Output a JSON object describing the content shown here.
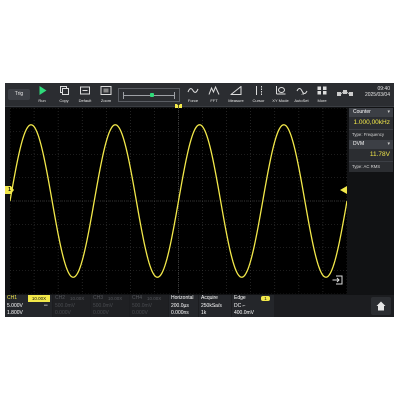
{
  "toolbar": {
    "trig": "Trig",
    "buttons": [
      "Run",
      "Copy",
      "Default",
      "Zoom",
      "Force",
      "FFT",
      "Measure",
      "Cursor",
      "XY Mode",
      "AutoSet",
      "More"
    ]
  },
  "status": {
    "time": "09:40",
    "date": "2025/03/04"
  },
  "markers": {
    "trigger_level": "T",
    "ch1": "1"
  },
  "counter": {
    "title": "Counter",
    "value": "1.000,00kHz",
    "type": "Type: Frequency"
  },
  "dvm": {
    "title": "DVM",
    "value": "11.78V",
    "type": "Type: AC RMS"
  },
  "channels": [
    {
      "name": "CH1",
      "probe": "10.00X",
      "scale": "5.000V",
      "offset": "1.800V",
      "active": true
    },
    {
      "name": "CH2",
      "probe": "10.00X",
      "scale": "500.0mV",
      "offset": "0.000V",
      "active": false
    },
    {
      "name": "CH3",
      "probe": "10.00X",
      "scale": "500.0mV",
      "offset": "0.000V",
      "active": false
    },
    {
      "name": "CH4",
      "probe": "10.00X",
      "scale": "500.0mV",
      "offset": "0.000V",
      "active": false
    }
  ],
  "horizontal": {
    "title": "Horizontal",
    "timebase": "200.0µs",
    "delay": "0.000ns"
  },
  "acquire": {
    "title": "Acquire",
    "rate": "250kSa/s",
    "depth": "1k"
  },
  "edge": {
    "title": "Edge",
    "source": "1",
    "coupling": "DC",
    "level": "400.0mV"
  },
  "colors": {
    "ch1": "#f2e84a",
    "run": "#2fdb7a",
    "toolbar": "#2b2d31",
    "screen": "#000000"
  },
  "chart_data": {
    "type": "line",
    "title": "",
    "series": [
      {
        "name": "CH1",
        "waveform": "sine",
        "cycles_on_screen": 4,
        "frequency": "1.000,00kHz"
      }
    ]
  }
}
